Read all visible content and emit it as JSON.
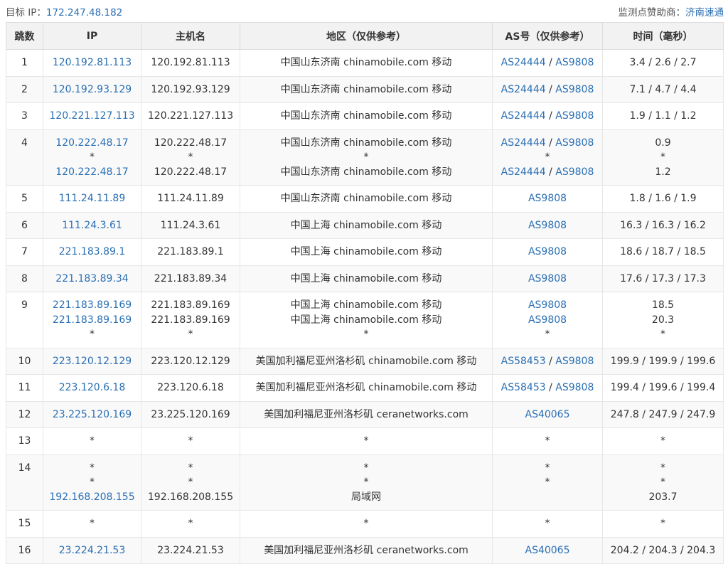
{
  "header": {
    "target_label": "目标 IP：",
    "target_ip": "172.247.48.182",
    "sponsor_label": "监测点赞助商：",
    "sponsor_name": "济南速通"
  },
  "columns": [
    "跳数",
    "IP",
    "主机名",
    "地区（仅供参考）",
    "AS号（仅供参考）",
    "时间（毫秒）"
  ],
  "colors": {
    "link": "#2a6fb3",
    "header_bg": "#f2f2f2",
    "stripe_bg": "#f9f9f9",
    "border": "#e6e6e6"
  },
  "hops": [
    {
      "hop": "1",
      "lines": [
        {
          "ip": "120.192.81.113",
          "host": "120.192.81.113",
          "region": "中国山东济南 chinamobile.com 移动",
          "as": [
            "AS24444",
            "AS9808"
          ],
          "time": "3.4 / 2.6 / 2.7"
        }
      ]
    },
    {
      "hop": "2",
      "lines": [
        {
          "ip": "120.192.93.129",
          "host": "120.192.93.129",
          "region": "中国山东济南 chinamobile.com 移动",
          "as": [
            "AS24444",
            "AS9808"
          ],
          "time": "7.1 / 4.7 / 4.4"
        }
      ]
    },
    {
      "hop": "3",
      "lines": [
        {
          "ip": "120.221.127.113",
          "host": "120.221.127.113",
          "region": "中国山东济南 chinamobile.com 移动",
          "as": [
            "AS24444",
            "AS9808"
          ],
          "time": "1.9 / 1.1 / 1.2"
        }
      ]
    },
    {
      "hop": "4",
      "lines": [
        {
          "ip": "120.222.48.17",
          "host": "120.222.48.17",
          "region": "中国山东济南 chinamobile.com 移动",
          "as": [
            "AS24444",
            "AS9808"
          ],
          "time": "0.9"
        },
        {
          "ip": "*",
          "host": "*",
          "region": "*",
          "as": [
            "*"
          ],
          "time": "*"
        },
        {
          "ip": "120.222.48.17",
          "host": "120.222.48.17",
          "region": "中国山东济南 chinamobile.com 移动",
          "as": [
            "AS24444",
            "AS9808"
          ],
          "time": "1.2"
        }
      ]
    },
    {
      "hop": "5",
      "lines": [
        {
          "ip": "111.24.11.89",
          "host": "111.24.11.89",
          "region": "中国山东济南 chinamobile.com 移动",
          "as": [
            "AS9808"
          ],
          "time": "1.8 / 1.6 / 1.9"
        }
      ]
    },
    {
      "hop": "6",
      "lines": [
        {
          "ip": "111.24.3.61",
          "host": "111.24.3.61",
          "region": "中国上海 chinamobile.com 移动",
          "as": [
            "AS9808"
          ],
          "time": "16.3 / 16.3 / 16.2"
        }
      ]
    },
    {
      "hop": "7",
      "lines": [
        {
          "ip": "221.183.89.1",
          "host": "221.183.89.1",
          "region": "中国上海 chinamobile.com 移动",
          "as": [
            "AS9808"
          ],
          "time": "18.6 / 18.7 / 18.5"
        }
      ]
    },
    {
      "hop": "8",
      "lines": [
        {
          "ip": "221.183.89.34",
          "host": "221.183.89.34",
          "region": "中国上海 chinamobile.com 移动",
          "as": [
            "AS9808"
          ],
          "time": "17.6 / 17.3 / 17.3"
        }
      ]
    },
    {
      "hop": "9",
      "lines": [
        {
          "ip": "221.183.89.169",
          "host": "221.183.89.169",
          "region": "中国上海 chinamobile.com 移动",
          "as": [
            "AS9808"
          ],
          "time": "18.5"
        },
        {
          "ip": "221.183.89.169",
          "host": "221.183.89.169",
          "region": "中国上海 chinamobile.com 移动",
          "as": [
            "AS9808"
          ],
          "time": "20.3"
        },
        {
          "ip": "*",
          "host": "*",
          "region": "*",
          "as": [
            "*"
          ],
          "time": "*"
        }
      ]
    },
    {
      "hop": "10",
      "lines": [
        {
          "ip": "223.120.12.129",
          "host": "223.120.12.129",
          "region": "美国加利福尼亚州洛杉矶 chinamobile.com 移动",
          "as": [
            "AS58453",
            "AS9808"
          ],
          "time": "199.9 / 199.9 / 199.6"
        }
      ]
    },
    {
      "hop": "11",
      "lines": [
        {
          "ip": "223.120.6.18",
          "host": "223.120.6.18",
          "region": "美国加利福尼亚州洛杉矶 chinamobile.com 移动",
          "as": [
            "AS58453",
            "AS9808"
          ],
          "time": "199.4 / 199.6 / 199.4"
        }
      ]
    },
    {
      "hop": "12",
      "lines": [
        {
          "ip": "23.225.120.169",
          "host": "23.225.120.169",
          "region": "美国加利福尼亚州洛杉矶 ceranetworks.com",
          "as": [
            "AS40065"
          ],
          "time": "247.8 / 247.9 / 247.9"
        }
      ]
    },
    {
      "hop": "13",
      "lines": [
        {
          "ip": "*",
          "host": "*",
          "region": "*",
          "as": [
            "*"
          ],
          "time": "*"
        }
      ]
    },
    {
      "hop": "14",
      "lines": [
        {
          "ip": "*",
          "host": "*",
          "region": "*",
          "as": [
            "*"
          ],
          "time": "*"
        },
        {
          "ip": "*",
          "host": "*",
          "region": "*",
          "as": [
            "*"
          ],
          "time": "*"
        },
        {
          "ip": "192.168.208.155",
          "host": "192.168.208.155",
          "region": "局域网",
          "as": [
            ""
          ],
          "time": "203.7"
        }
      ]
    },
    {
      "hop": "15",
      "lines": [
        {
          "ip": "*",
          "host": "*",
          "region": "*",
          "as": [
            "*"
          ],
          "time": "*"
        }
      ]
    },
    {
      "hop": "16",
      "lines": [
        {
          "ip": "23.224.21.53",
          "host": "23.224.21.53",
          "region": "美国加利福尼亚州洛杉矶 ceranetworks.com",
          "as": [
            "AS40065"
          ],
          "time": "204.2 / 204.3 / 204.3"
        }
      ]
    }
  ]
}
